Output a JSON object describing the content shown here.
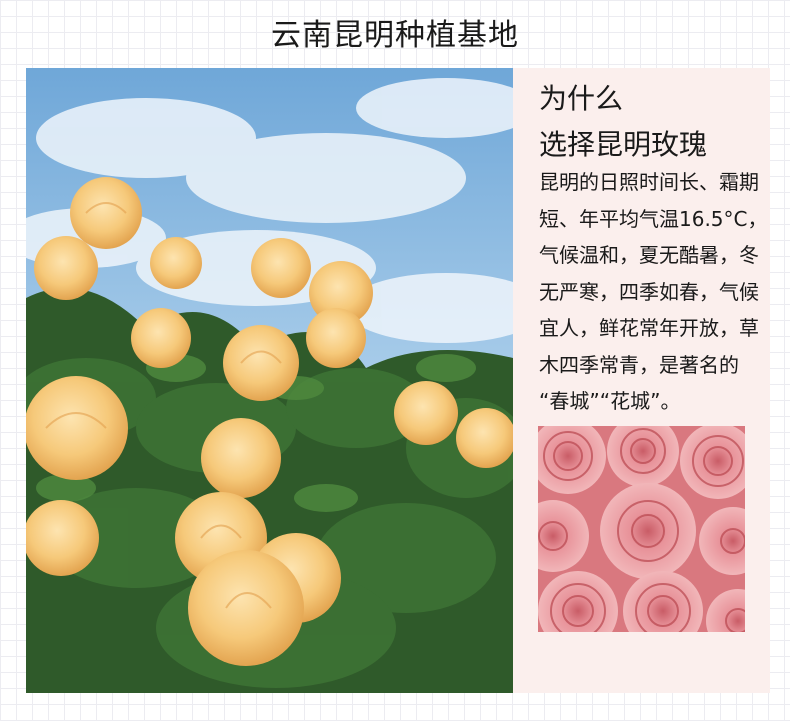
{
  "page": {
    "title": "云南昆明种植基地"
  },
  "info": {
    "heading_lines": [
      "为什么",
      "选择昆明玫瑰"
    ],
    "body_lines": [
      "昆明的日照时间长、霜期",
      "短、年平均气温16.5°C，",
      "气候温和，夏无酷暑，冬",
      "无严寒，四季如春，气候",
      "宜人，鲜花常年开放，草",
      "木四季常青，是著名的",
      "“春城”“花城”。"
    ]
  },
  "images": {
    "main_photo": "yellow-roses-blue-sky-photo",
    "rose_photo": "pink-roses-closeup-photo"
  },
  "colors": {
    "panel_background": "#fbefed",
    "title_text": "#1a1a1a",
    "grid_line": "#ececf1"
  }
}
